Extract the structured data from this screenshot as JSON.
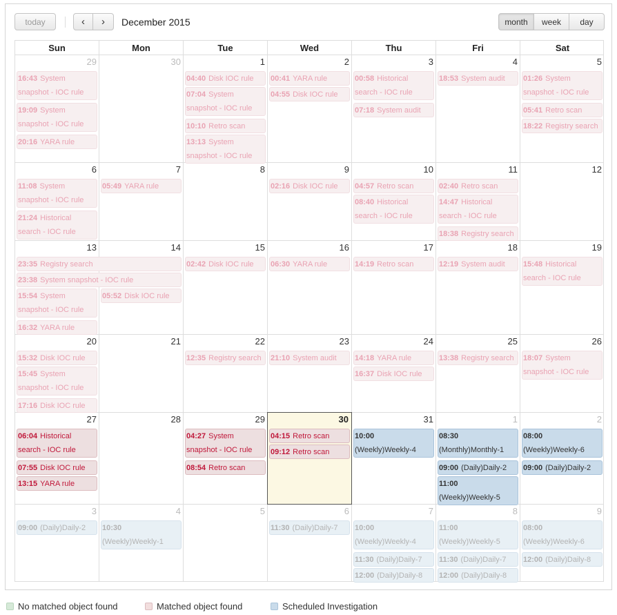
{
  "toolbar": {
    "today_label": "today",
    "prev_icon": "‹",
    "next_icon": "›",
    "title": "December 2015",
    "views": [
      "month",
      "week",
      "day"
    ],
    "active_view": "month"
  },
  "weekdays": [
    "Sun",
    "Mon",
    "Tue",
    "Wed",
    "Thu",
    "Fri",
    "Sat"
  ],
  "today": "2015-12-30",
  "colors": {
    "no_match": "#d6e9d8",
    "match": "#f2dede",
    "scheduled": "#c9dbea",
    "today_bg": "#fcf8e3"
  },
  "weeks": [
    {
      "days": [
        {
          "n": "29",
          "other": true
        },
        {
          "n": "30",
          "other": true
        },
        {
          "n": "1"
        },
        {
          "n": "2"
        },
        {
          "n": "3"
        },
        {
          "n": "4"
        },
        {
          "n": "5"
        }
      ]
    },
    {
      "days": [
        {
          "n": "6"
        },
        {
          "n": "7"
        },
        {
          "n": "8"
        },
        {
          "n": "9"
        },
        {
          "n": "10"
        },
        {
          "n": "11"
        },
        {
          "n": "12"
        }
      ]
    },
    {
      "days": [
        {
          "n": "13"
        },
        {
          "n": "14"
        },
        {
          "n": "15"
        },
        {
          "n": "16"
        },
        {
          "n": "17"
        },
        {
          "n": "18"
        },
        {
          "n": "19"
        }
      ]
    },
    {
      "days": [
        {
          "n": "20"
        },
        {
          "n": "21"
        },
        {
          "n": "22"
        },
        {
          "n": "23"
        },
        {
          "n": "24"
        },
        {
          "n": "25"
        },
        {
          "n": "26"
        }
      ]
    },
    {
      "days": [
        {
          "n": "27"
        },
        {
          "n": "28"
        },
        {
          "n": "29"
        },
        {
          "n": "30",
          "today": true
        },
        {
          "n": "31"
        },
        {
          "n": "1",
          "other": true
        },
        {
          "n": "2",
          "other": true
        }
      ]
    },
    {
      "days": [
        {
          "n": "3",
          "other": true
        },
        {
          "n": "4",
          "other": true
        },
        {
          "n": "5",
          "other": true
        },
        {
          "n": "6",
          "other": true
        },
        {
          "n": "7",
          "other": true
        },
        {
          "n": "8",
          "other": true
        },
        {
          "n": "9",
          "other": true
        }
      ]
    }
  ],
  "events": [
    {
      "week": 0,
      "day": 0,
      "slot": 0,
      "lines": 2,
      "time": "16:43",
      "title": "System snapshot - IOC rule",
      "type": "match",
      "faded": true
    },
    {
      "week": 0,
      "day": 0,
      "slot": 2,
      "lines": 2,
      "time": "19:09",
      "title": "System snapshot - IOC rule",
      "type": "match",
      "faded": true
    },
    {
      "week": 0,
      "day": 0,
      "slot": 4,
      "lines": 1,
      "time": "20:16",
      "title": "YARA rule",
      "type": "match",
      "faded": true
    },
    {
      "week": 0,
      "day": 2,
      "slot": 0,
      "lines": 1,
      "time": "04:40",
      "title": "Disk IOC rule",
      "type": "match",
      "faded": true
    },
    {
      "week": 0,
      "day": 2,
      "slot": 1,
      "lines": 2,
      "time": "07:04",
      "title": "System snapshot - IOC rule",
      "type": "match",
      "faded": true
    },
    {
      "week": 0,
      "day": 2,
      "slot": 3,
      "lines": 1,
      "time": "10:10",
      "title": "Retro scan",
      "type": "match",
      "faded": true
    },
    {
      "week": 0,
      "day": 2,
      "slot": 4,
      "lines": 2,
      "time": "13:13",
      "title": "System snapshot - IOC rule",
      "type": "match",
      "faded": true
    },
    {
      "week": 0,
      "day": 3,
      "slot": 0,
      "lines": 1,
      "time": "00:41",
      "title": "YARA rule",
      "type": "match",
      "faded": true
    },
    {
      "week": 0,
      "day": 3,
      "slot": 1,
      "lines": 1,
      "time": "04:55",
      "title": "Disk IOC rule",
      "type": "match",
      "faded": true
    },
    {
      "week": 0,
      "day": 4,
      "slot": 0,
      "lines": 2,
      "time": "00:58",
      "title": "Historical search - IOC rule",
      "type": "match",
      "faded": true
    },
    {
      "week": 0,
      "day": 4,
      "slot": 2,
      "lines": 1,
      "time": "07:18",
      "title": "System audit",
      "type": "match",
      "faded": true
    },
    {
      "week": 0,
      "day": 5,
      "slot": 0,
      "lines": 1,
      "time": "18:53",
      "title": "System audit",
      "type": "match",
      "faded": true
    },
    {
      "week": 0,
      "day": 6,
      "slot": 0,
      "lines": 2,
      "time": "01:26",
      "title": "System snapshot - IOC rule",
      "type": "match",
      "faded": true
    },
    {
      "week": 0,
      "day": 6,
      "slot": 2,
      "lines": 1,
      "time": "05:41",
      "title": "Retro scan",
      "type": "match",
      "faded": true
    },
    {
      "week": 0,
      "day": 6,
      "slot": 3,
      "lines": 1,
      "time": "18:22",
      "title": "Registry search",
      "type": "match",
      "faded": true
    },
    {
      "week": 1,
      "day": 0,
      "slot": 0,
      "lines": 2,
      "time": "11:08",
      "title": "System snapshot - IOC rule",
      "type": "match",
      "faded": true
    },
    {
      "week": 1,
      "day": 0,
      "slot": 2,
      "lines": 2,
      "time": "21:24",
      "title": "Historical search - IOC rule",
      "type": "match",
      "faded": true
    },
    {
      "week": 1,
      "day": 1,
      "slot": 0,
      "lines": 1,
      "time": "05:49",
      "title": "YARA rule",
      "type": "match",
      "faded": true
    },
    {
      "week": 1,
      "day": 3,
      "slot": 0,
      "lines": 1,
      "time": "02:16",
      "title": "Disk IOC rule",
      "type": "match",
      "faded": true
    },
    {
      "week": 1,
      "day": 4,
      "slot": 0,
      "lines": 1,
      "time": "04:57",
      "title": "Retro scan",
      "type": "match",
      "faded": true
    },
    {
      "week": 1,
      "day": 4,
      "slot": 1,
      "lines": 2,
      "time": "08:40",
      "title": "Historical search - IOC rule",
      "type": "match",
      "faded": true
    },
    {
      "week": 1,
      "day": 5,
      "slot": 0,
      "lines": 1,
      "time": "02:40",
      "title": "Retro scan",
      "type": "match",
      "faded": true
    },
    {
      "week": 1,
      "day": 5,
      "slot": 1,
      "lines": 2,
      "time": "14:47",
      "title": "Historical search - IOC rule",
      "type": "match",
      "faded": true
    },
    {
      "week": 1,
      "day": 5,
      "slot": 3,
      "lines": 1,
      "time": "18:38",
      "title": "Registry search",
      "type": "match",
      "faded": true
    },
    {
      "week": 2,
      "day": 0,
      "span": 2,
      "slot": 0,
      "lines": 1,
      "time": "23:35",
      "title": "Registry search",
      "type": "match",
      "faded": true
    },
    {
      "week": 2,
      "day": 0,
      "span": 2,
      "slot": 1,
      "lines": 1,
      "time": "23:38",
      "title": "System snapshot - IOC rule",
      "type": "match",
      "faded": true
    },
    {
      "week": 2,
      "day": 0,
      "slot": 2,
      "lines": 2,
      "time": "15:54",
      "title": "System snapshot - IOC rule",
      "type": "match",
      "faded": true
    },
    {
      "week": 2,
      "day": 0,
      "slot": 4,
      "lines": 1,
      "time": "16:32",
      "title": "YARA rule",
      "type": "match",
      "faded": true
    },
    {
      "week": 2,
      "day": 1,
      "slot": 2,
      "lines": 1,
      "time": "05:52",
      "title": "Disk IOC rule",
      "type": "match",
      "faded": true
    },
    {
      "week": 2,
      "day": 2,
      "slot": 0,
      "lines": 1,
      "time": "02:42",
      "title": "Disk IOC rule",
      "type": "match",
      "faded": true
    },
    {
      "week": 2,
      "day": 3,
      "slot": 0,
      "lines": 1,
      "time": "06:30",
      "title": "YARA rule",
      "type": "match",
      "faded": true
    },
    {
      "week": 2,
      "day": 4,
      "slot": 0,
      "lines": 1,
      "time": "14:19",
      "title": "Retro scan",
      "type": "match",
      "faded": true
    },
    {
      "week": 2,
      "day": 5,
      "slot": 0,
      "lines": 1,
      "time": "12:19",
      "title": "System audit",
      "type": "match",
      "faded": true
    },
    {
      "week": 2,
      "day": 6,
      "slot": 0,
      "lines": 2,
      "time": "15:48",
      "title": "Historical search - IOC rule",
      "type": "match",
      "faded": true
    },
    {
      "week": 3,
      "day": 0,
      "slot": 0,
      "lines": 1,
      "time": "15:32",
      "title": "Disk IOC rule",
      "type": "match",
      "faded": true
    },
    {
      "week": 3,
      "day": 0,
      "slot": 1,
      "lines": 2,
      "time": "15:45",
      "title": "System snapshot - IOC rule",
      "type": "match",
      "faded": true
    },
    {
      "week": 3,
      "day": 0,
      "slot": 3,
      "lines": 1,
      "time": "17:16",
      "title": "Disk IOC rule",
      "type": "match",
      "faded": true
    },
    {
      "week": 3,
      "day": 2,
      "slot": 0,
      "lines": 1,
      "time": "12:35",
      "title": "Registry search",
      "type": "match",
      "faded": true
    },
    {
      "week": 3,
      "day": 3,
      "slot": 0,
      "lines": 1,
      "time": "21:10",
      "title": "System audit",
      "type": "match",
      "faded": true
    },
    {
      "week": 3,
      "day": 4,
      "slot": 0,
      "lines": 1,
      "time": "14:18",
      "title": "YARA rule",
      "type": "match",
      "faded": true
    },
    {
      "week": 3,
      "day": 4,
      "slot": 1,
      "lines": 1,
      "time": "16:37",
      "title": "Disk IOC rule",
      "type": "match",
      "faded": true
    },
    {
      "week": 3,
      "day": 5,
      "slot": 0,
      "lines": 1,
      "time": "13:38",
      "title": "Registry search",
      "type": "match",
      "faded": true
    },
    {
      "week": 3,
      "day": 6,
      "slot": 0,
      "lines": 2,
      "time": "18:07",
      "title": "System snapshot - IOC rule",
      "type": "match",
      "faded": true
    },
    {
      "week": 4,
      "day": 0,
      "slot": 0,
      "lines": 2,
      "time": "06:04",
      "title": "Historical search - IOC rule",
      "type": "match",
      "faded": false
    },
    {
      "week": 4,
      "day": 0,
      "slot": 2,
      "lines": 1,
      "time": "07:55",
      "title": "Disk IOC rule",
      "type": "match",
      "faded": false
    },
    {
      "week": 4,
      "day": 0,
      "slot": 3,
      "lines": 1,
      "time": "13:15",
      "title": "YARA rule",
      "type": "match",
      "faded": false
    },
    {
      "week": 4,
      "day": 2,
      "slot": 0,
      "lines": 2,
      "time": "04:27",
      "title": "System snapshot - IOC rule",
      "type": "match",
      "faded": false
    },
    {
      "week": 4,
      "day": 2,
      "slot": 2,
      "lines": 1,
      "time": "08:54",
      "title": "Retro scan",
      "type": "match",
      "faded": false
    },
    {
      "week": 4,
      "day": 3,
      "slot": 0,
      "lines": 1,
      "time": "04:15",
      "title": "Retro scan",
      "type": "match",
      "faded": false
    },
    {
      "week": 4,
      "day": 3,
      "slot": 1,
      "lines": 1,
      "time": "09:12",
      "title": "Retro scan",
      "type": "match",
      "faded": false
    },
    {
      "week": 4,
      "day": 4,
      "slot": 0,
      "lines": 2,
      "time": "10:00",
      "title": "(Weekly)Weekly-4",
      "type": "sched",
      "faded": false,
      "break": true
    },
    {
      "week": 4,
      "day": 5,
      "slot": 0,
      "lines": 2,
      "time": "08:30",
      "title": "(Monthly)Monthly-1",
      "type": "sched",
      "faded": false,
      "break": true
    },
    {
      "week": 4,
      "day": 5,
      "slot": 2,
      "lines": 1,
      "time": "09:00",
      "title": "(Daily)Daily-2",
      "type": "sched",
      "faded": false
    },
    {
      "week": 4,
      "day": 5,
      "slot": 3,
      "lines": 2,
      "time": "11:00",
      "title": "(Weekly)Weekly-5",
      "type": "sched",
      "faded": false,
      "break": true
    },
    {
      "week": 4,
      "day": 6,
      "slot": 0,
      "lines": 2,
      "time": "08:00",
      "title": "(Weekly)Weekly-6",
      "type": "sched",
      "faded": false,
      "break": true
    },
    {
      "week": 4,
      "day": 6,
      "slot": 2,
      "lines": 1,
      "time": "09:00",
      "title": "(Daily)Daily-2",
      "type": "sched",
      "faded": false
    },
    {
      "week": 5,
      "day": 0,
      "slot": 0,
      "lines": 1,
      "time": "09:00",
      "title": "(Daily)Daily-2",
      "type": "sched",
      "faded": true
    },
    {
      "week": 5,
      "day": 1,
      "slot": 0,
      "lines": 2,
      "time": "10:30",
      "title": "(Weekly)Weekly-1",
      "type": "sched",
      "faded": true,
      "break": true
    },
    {
      "week": 5,
      "day": 3,
      "slot": 0,
      "lines": 1,
      "time": "11:30",
      "title": "(Daily)Daily-7",
      "type": "sched",
      "faded": true
    },
    {
      "week": 5,
      "day": 4,
      "slot": 0,
      "lines": 2,
      "time": "10:00",
      "title": "(Weekly)Weekly-4",
      "type": "sched",
      "faded": true,
      "break": true
    },
    {
      "week": 5,
      "day": 4,
      "slot": 2,
      "lines": 1,
      "time": "11:30",
      "title": "(Daily)Daily-7",
      "type": "sched",
      "faded": true
    },
    {
      "week": 5,
      "day": 4,
      "slot": 3,
      "lines": 1,
      "time": "12:00",
      "title": "(Daily)Daily-8",
      "type": "sched",
      "faded": true
    },
    {
      "week": 5,
      "day": 5,
      "slot": 0,
      "lines": 2,
      "time": "11:00",
      "title": "(Weekly)Weekly-5",
      "type": "sched",
      "faded": true,
      "break": true
    },
    {
      "week": 5,
      "day": 5,
      "slot": 2,
      "lines": 1,
      "time": "11:30",
      "title": "(Daily)Daily-7",
      "type": "sched",
      "faded": true
    },
    {
      "week": 5,
      "day": 5,
      "slot": 3,
      "lines": 1,
      "time": "12:00",
      "title": "(Daily)Daily-8",
      "type": "sched",
      "faded": true
    },
    {
      "week": 5,
      "day": 6,
      "slot": 0,
      "lines": 2,
      "time": "08:00",
      "title": "(Weekly)Weekly-6",
      "type": "sched",
      "faded": true,
      "break": true
    },
    {
      "week": 5,
      "day": 6,
      "slot": 2,
      "lines": 1,
      "time": "12:00",
      "title": "(Daily)Daily-8",
      "type": "sched",
      "faded": true
    }
  ],
  "legend": [
    {
      "label": "No matched object found",
      "color": "#d6e9d8",
      "border": "#b9d7bd"
    },
    {
      "label": "Matched object found",
      "color": "#f2dede",
      "border": "#dcbcbf"
    },
    {
      "label": "Scheduled Investigation",
      "color": "#c9dbea",
      "border": "#a9c3da"
    }
  ]
}
